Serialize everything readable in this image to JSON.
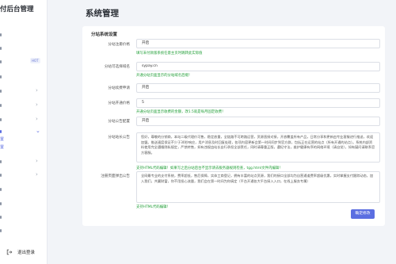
{
  "sidebar": {
    "brand": "付后台管理",
    "hot_badge": "HOT",
    "sub_items": [
      "置",
      "置"
    ],
    "logout_label": "退出登录"
  },
  "page_title": "系统管理",
  "card": {
    "title": "分站系统设置",
    "fields": [
      {
        "label": "分站注册价格",
        "value": "开启",
        "hint": "填写未付款版系统任意主页时跳转此实际值"
      },
      {
        "label": "分站可选择域名",
        "value": "sypay.cn",
        "hint": "开通分站页面显示的分站域名后缀！"
      },
      {
        "label": "分站续费申请",
        "value": "开启",
        "hint": ""
      },
      {
        "label": "分站开通价格",
        "value": "5",
        "hint": "开通分站页面显示收费的金额，改1.5就是每月固定收费！"
      },
      {
        "label": "分站公告配置",
        "value": "开启",
        "hint": ""
      }
    ],
    "announcement": {
      "label": "分站站长公告",
      "text": "您好，尊敬的分销商，本站二级代理价可售，稳定放量，全链路不可跨路运营，资源直接对接，开放覆盖所有产品，日常分享和更新由专业客服进行推送，欢迎加盟。推送速度保证不少于30秒响应，用户消息及时回复处理，各项内容更新会第一时间同步到官方群，包括正在运营的站点（所有开通的站点）。系统内部资料使用完全遵循隐私规定，严禁转售，如有违规由站长自行承担全部责任，同时请尊重正版，遵纪守法，维护健康有序的网络环境（请自觉），如有疑问请联系官方客服。",
      "hint": "支持HTML代码编辑！如果写之后分站后台不显示请去服务器规则检查，tgg.html文件内编辑！"
    },
    "register_notice": {
      "label": "注册页面弹出公告",
      "text": "全网最专业的支付系统，费率超低，售后保障，实体工商登记，拥有丰富的站点资源，我们的接口全部均为自营通道费率超级优惠，实时掌握支付跟踪动态，加入我们，共赢财富，你不用担心流量，我们会在第一时间为你搞定（平台开通各大平台接入入口，在线上服务专属）",
      "hint": "支持HTML代码编辑！"
    },
    "confirm_label": "确定修改"
  }
}
